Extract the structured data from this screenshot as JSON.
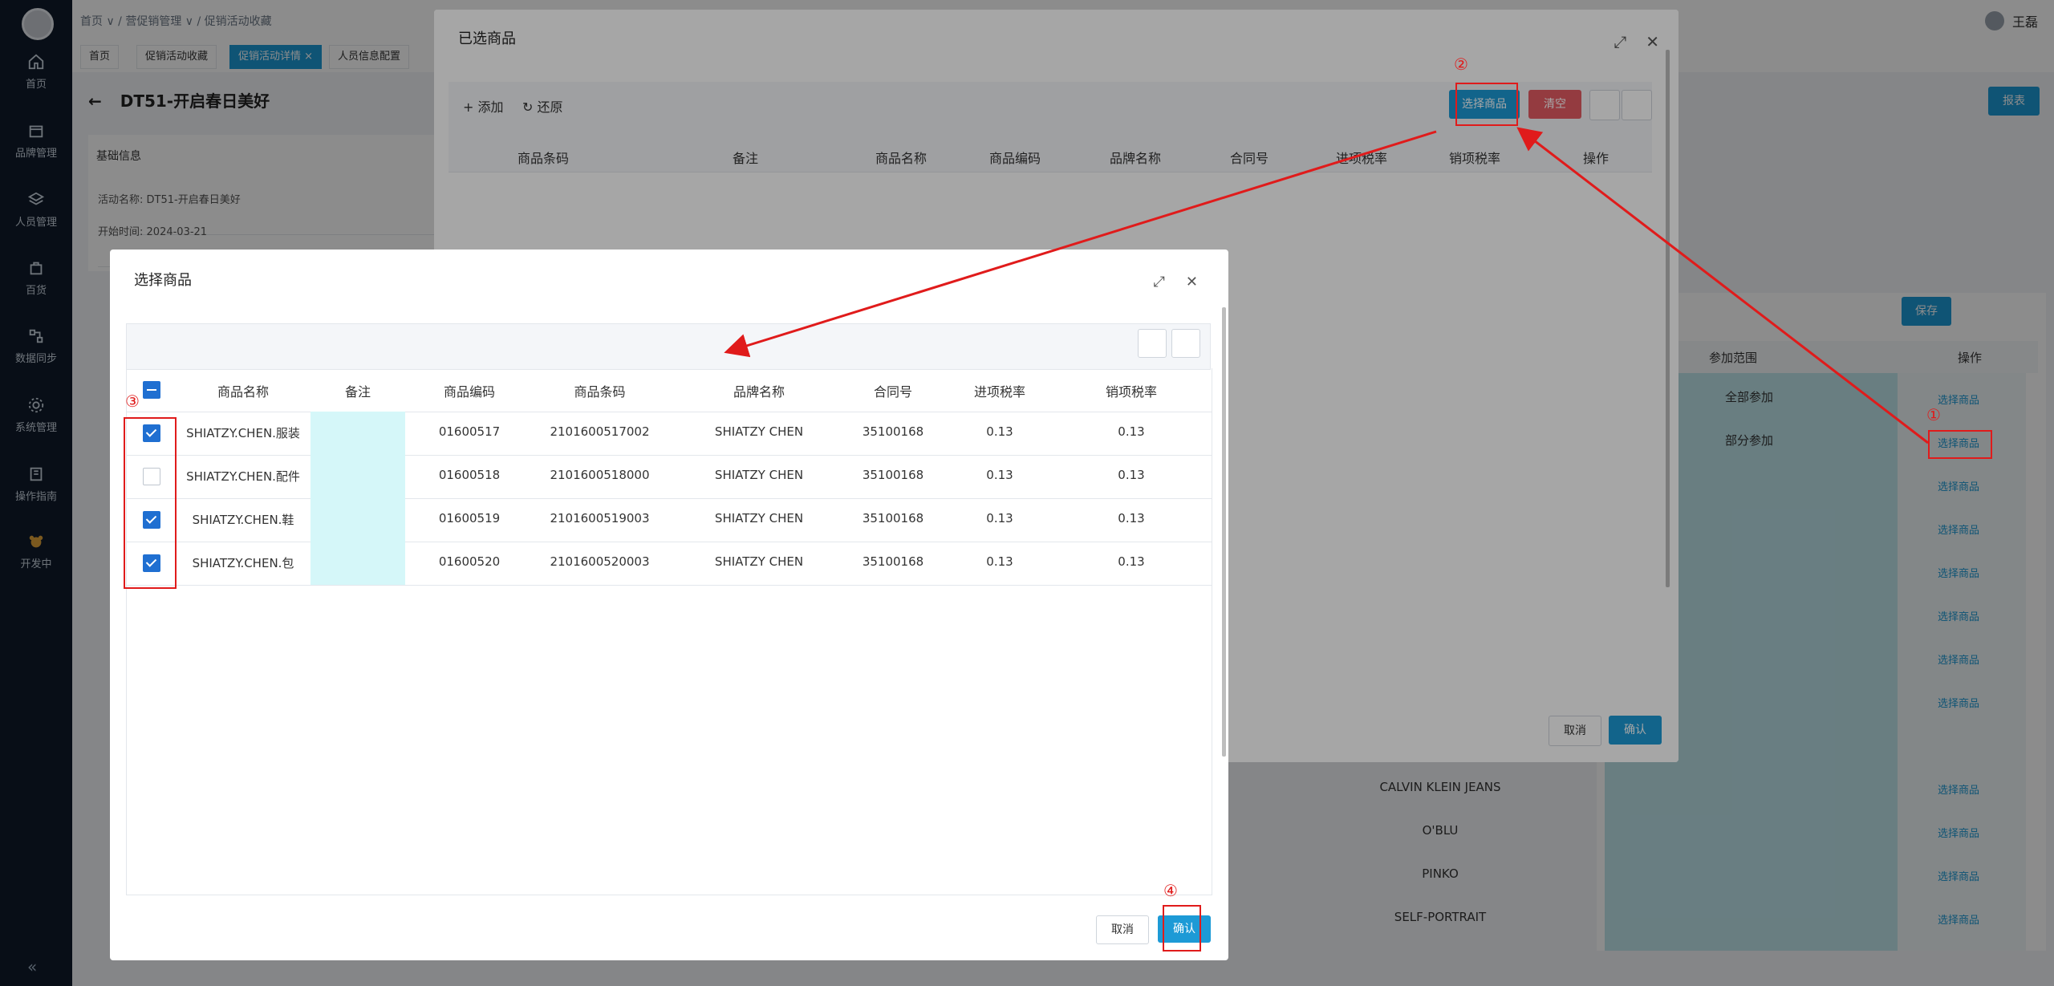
{
  "app": {
    "breadcrumb": "首页 ∨ / 营促销管理 ∨ / 促销活动收藏",
    "user_name": "王磊",
    "tabs": [
      "首页",
      "促销活动收藏",
      "促销活动详情 ×",
      "人员信息配置"
    ],
    "sidebar": [
      {
        "label": "首页",
        "icon": "home-icon"
      },
      {
        "label": "品牌管理",
        "icon": "box-icon"
      },
      {
        "label": "人员管理",
        "icon": "layers-icon"
      },
      {
        "label": "百货",
        "icon": "bag-icon"
      },
      {
        "label": "数据同步",
        "icon": "sync-icon"
      },
      {
        "label": "系统管理",
        "icon": "gear-icon"
      },
      {
        "label": "操作指南",
        "icon": "book-icon"
      },
      {
        "label": "开发中",
        "icon": "bear-icon"
      }
    ],
    "collapse": "«"
  },
  "page": {
    "back": "←",
    "title": "DT51-开启春日美好",
    "basic_info_header": "基础信息",
    "activity_name_label": "活动名称:",
    "activity_name_value": "DT51-开启春日美好",
    "start_time_label": "开始时间:",
    "start_time_value": "2024-03-21",
    "report_button": "报表",
    "right_panel": {
      "save": "保存",
      "scope_header": "参加范围",
      "op_header": "操作",
      "scope_rows": [
        "全部参加",
        "部分参加"
      ],
      "op_rows": [
        "选择商品",
        "选择商品",
        "选择商品",
        "选择商品",
        "选择商品",
        "选择商品",
        "选择商品",
        "选择商品",
        "选择商品",
        "选择商品",
        "选择商品",
        "选择商品"
      ]
    },
    "brand_rows": [
      "CALVIN KLEIN JEANS",
      "O'BLU",
      "PINKO",
      "SELF-PORTRAIT"
    ]
  },
  "selected_dialog": {
    "title": "已选商品",
    "add": "+ 添加",
    "restore": "↻ 还原",
    "select_goods": "选择商品",
    "clear": "清空",
    "columns": [
      "商品条码",
      "备注",
      "商品名称",
      "商品编码",
      "品牌名称",
      "合同号",
      "进项税率",
      "销项税率",
      "操作"
    ],
    "cancel": "取消",
    "confirm": "确认"
  },
  "select_dialog": {
    "title": "选择商品",
    "columns": [
      "商品名称",
      "备注",
      "商品编码",
      "商品条码",
      "品牌名称",
      "合同号",
      "进项税率",
      "销项税率"
    ],
    "rows": [
      {
        "checked": true,
        "name": "SHIATZY.CHEN.服装",
        "note": "",
        "code": "01600517",
        "barcode": "2101600517002",
        "brand": "SHIATZY CHEN",
        "contract": "35100168",
        "in_tax": "0.13",
        "out_tax": "0.13"
      },
      {
        "checked": false,
        "name": "SHIATZY.CHEN.配件",
        "note": "",
        "code": "01600518",
        "barcode": "2101600518000",
        "brand": "SHIATZY CHEN",
        "contract": "35100168",
        "in_tax": "0.13",
        "out_tax": "0.13"
      },
      {
        "checked": true,
        "name": "SHIATZY.CHEN.鞋",
        "note": "",
        "code": "01600519",
        "barcode": "2101600519003",
        "brand": "SHIATZY CHEN",
        "contract": "35100168",
        "in_tax": "0.13",
        "out_tax": "0.13"
      },
      {
        "checked": true,
        "name": "SHIATZY.CHEN.包",
        "note": "",
        "code": "01600520",
        "barcode": "2101600520003",
        "brand": "SHIATZY CHEN",
        "contract": "35100168",
        "in_tax": "0.13",
        "out_tax": "0.13"
      }
    ],
    "cancel": "取消",
    "confirm": "确认"
  },
  "annotations": {
    "n1": "①",
    "n2": "②",
    "n3": "③",
    "n4": "④"
  },
  "colors": {
    "accent": "#1d9ad6",
    "danger": "#e35b63",
    "annotation": "#e01b1b",
    "checkbox": "#1f6fd1"
  }
}
